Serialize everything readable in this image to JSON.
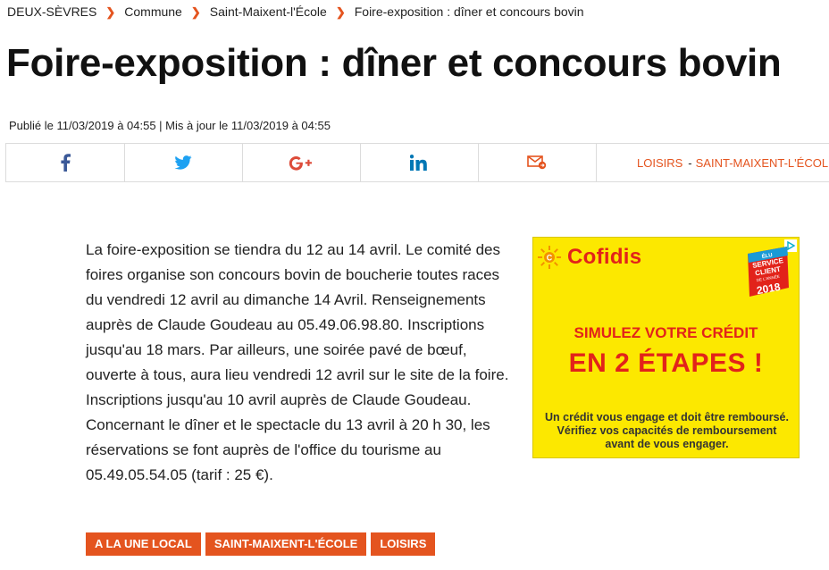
{
  "breadcrumb": [
    "DEUX-SÈVRES",
    "Commune",
    "Saint-Maixent-l'École",
    "Foire-exposition : dîner et concours bovin"
  ],
  "article": {
    "title": "Foire-exposition : dîner et concours bovin",
    "dates": "Publié le 11/03/2019 à 04:55 | Mis à jour le 11/03/2019 à 04:55",
    "body": "La foire-exposition se tiendra du 12 au 14 avril. Le comité des foires organise son concours bovin de boucherie toutes races du vendredi 12 avril au dimanche 14 Avril. Renseignements auprès de Claude Goudeau au 05.49.06.98.80. Inscriptions jusqu'au 18 mars. Par ailleurs, une soirée pavé de bœuf, ouverte à tous, aura lieu vendredi 12 avril sur le site de la foire. Inscriptions jusqu'au 10 avril auprès de Claude Goudeau. Concernant le dîner et le spectacle du 13 avril à 20 h 30, les réservations se font auprès de l'office du tourisme au 05.49.05.54.05 (tarif : 25 €)."
  },
  "share": {
    "icons": [
      "facebook-icon",
      "twitter-icon",
      "google-plus-icon",
      "linkedin-icon",
      "email-icon"
    ],
    "tags": [
      "LOISIRS",
      "SAINT-MAIXENT-L'ÉCOLE"
    ]
  },
  "ad": {
    "brand": "Cofidis",
    "badge": [
      "ÉLU",
      "SERVICE",
      "CLIENT",
      "DE L'ANNÉE",
      "2018"
    ],
    "line1": "SIMULEZ VOTRE CRÉDIT",
    "line2": "EN 2 ÉTAPES !",
    "disclaimer": "Un crédit vous engage et doit être remboursé. Vérifiez vos capacités de remboursement avant de vous engager.",
    "colors": {
      "background": "#fce800",
      "text": "#e2231a"
    }
  },
  "tags": [
    "A LA UNE LOCAL",
    "SAINT-MAIXENT-L'ÉCOLE",
    "LOISIRS"
  ],
  "colors": {
    "accent": "#e4541f",
    "facebook": "#3b5998",
    "twitter": "#1da1f2",
    "google": "#dd4b39",
    "linkedin": "#0077b5"
  }
}
